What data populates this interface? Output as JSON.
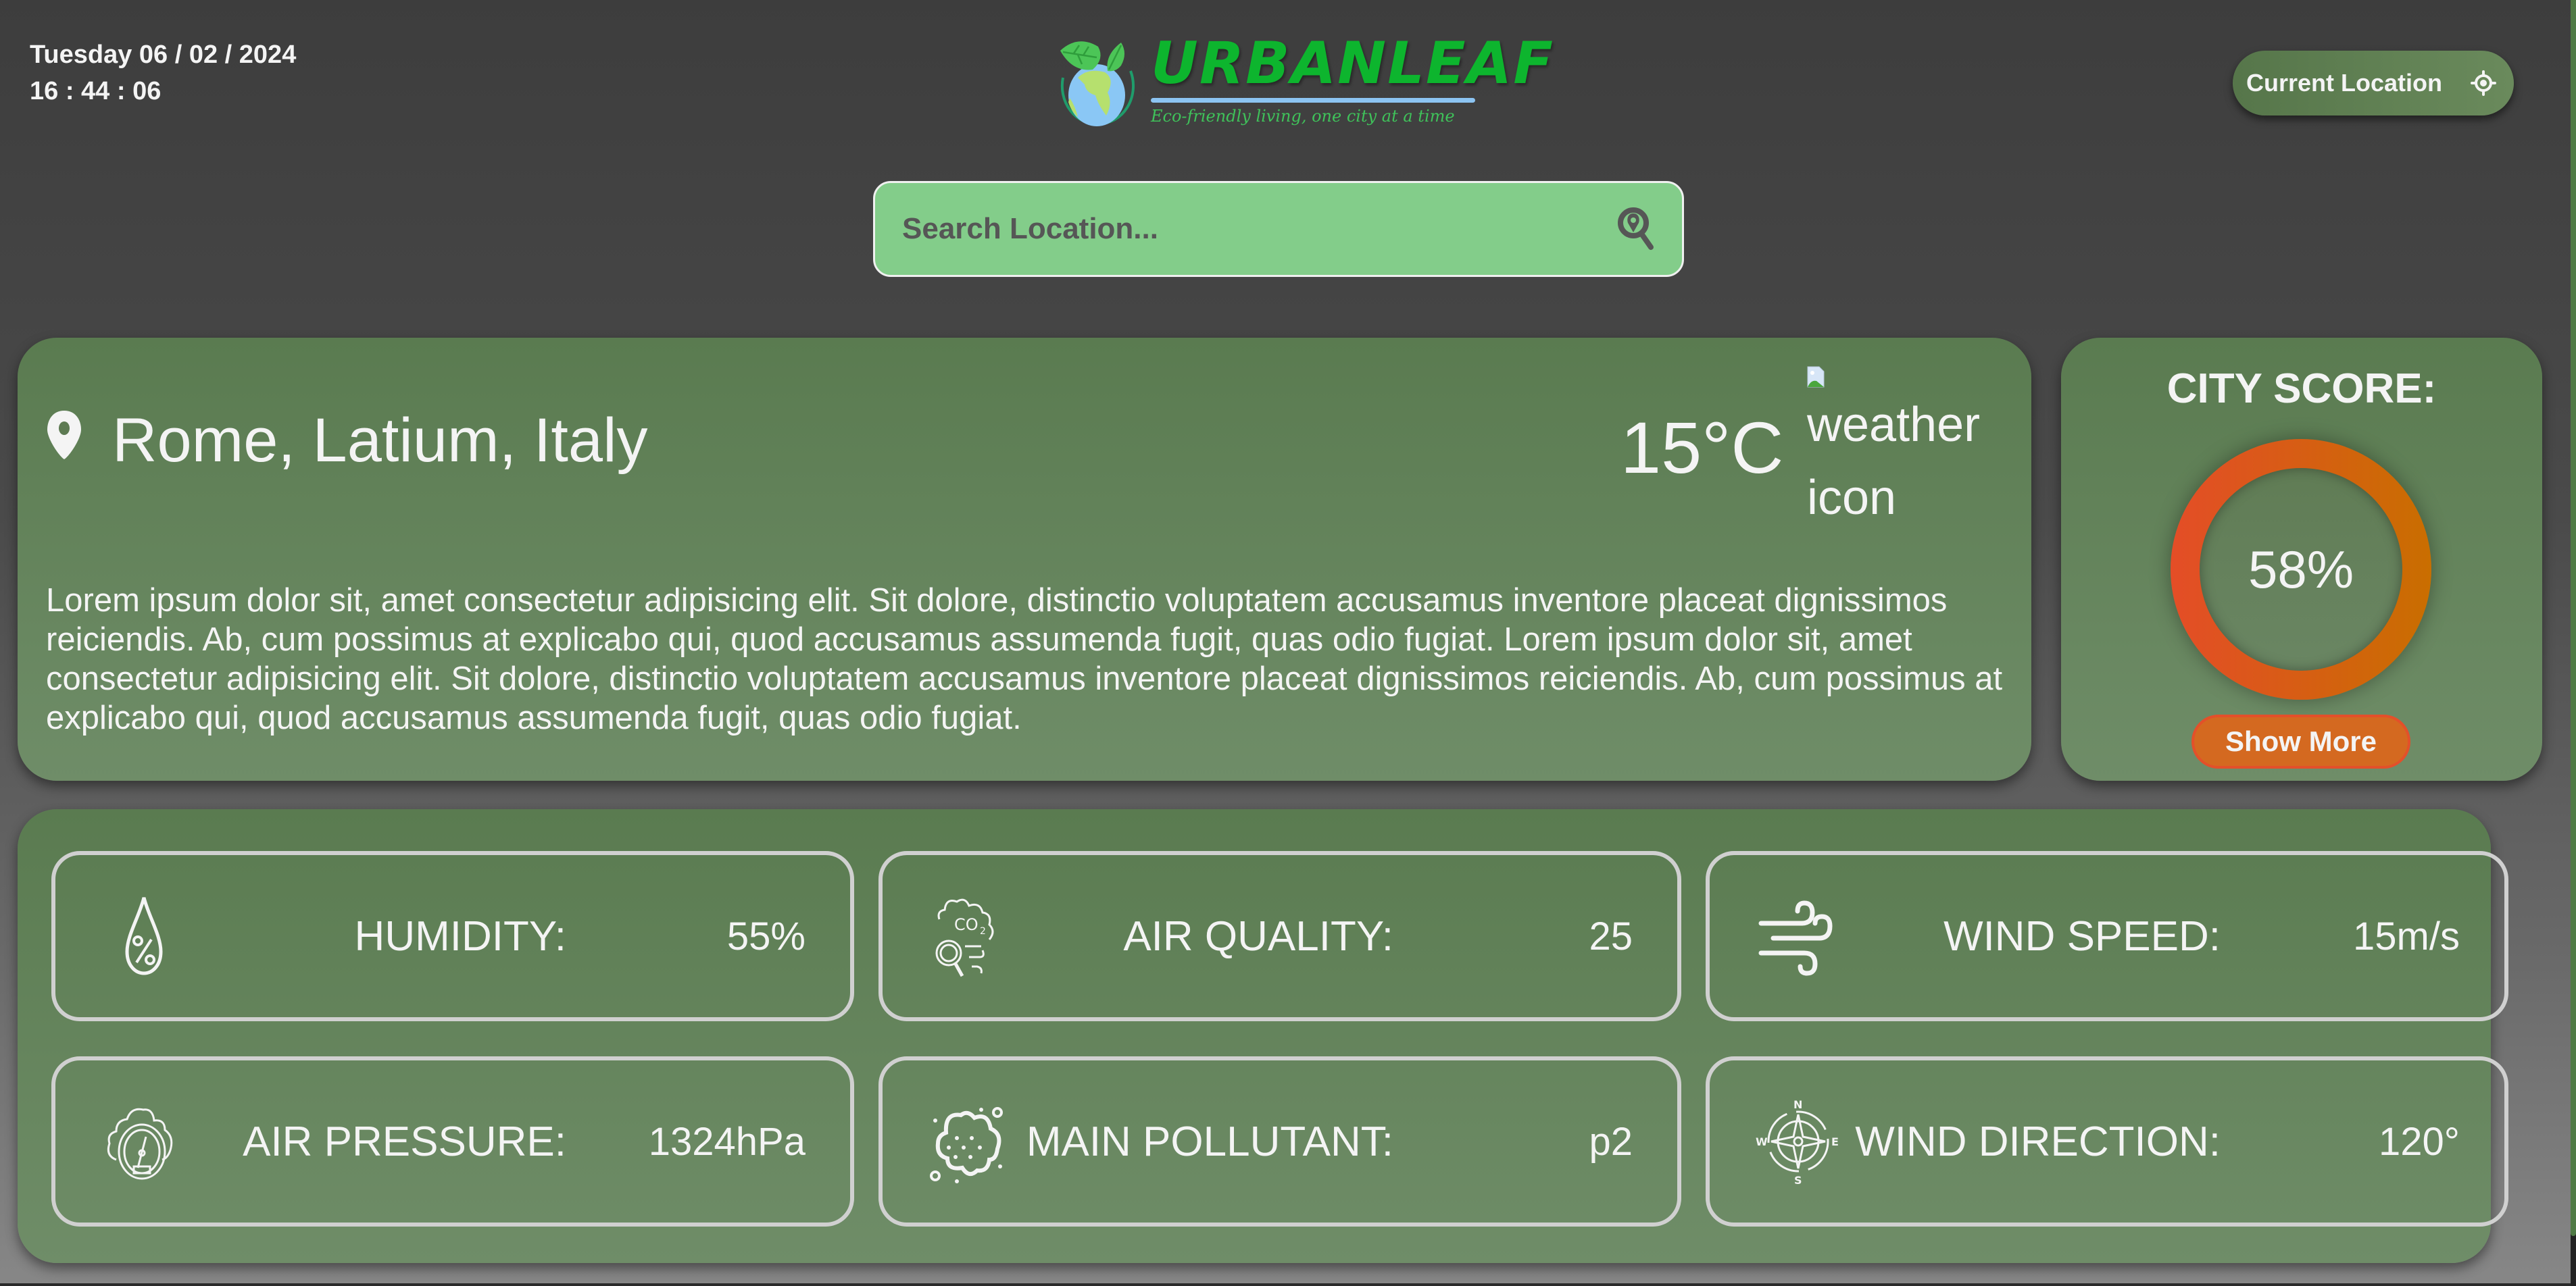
{
  "header": {
    "date": "Tuesday 06 / 02 / 2024",
    "time": "16 : 44 : 06",
    "logo_title": "URBANLEAF",
    "logo_tagline": "Eco-friendly living, one city at a time",
    "current_location_label": "Current Location"
  },
  "search": {
    "placeholder": "Search Location...",
    "value": ""
  },
  "location": {
    "name": "Rome, Latium, Italy",
    "temperature": "15°C",
    "weather_icon_alt": "weather icon",
    "description": "Lorem ipsum dolor sit, amet consectetur adipisicing elit. Sit dolore, distinctio voluptatem accusamus inventore placeat dignissimos reiciendis. Ab, cum possimus at explicabo qui, quod accusamus assumenda fugit, quas odio fugiat. Lorem ipsum dolor sit, amet consectetur adipisicing elit. Sit dolore, distinctio voluptatem accusamus inventore placeat dignissimos reiciendis. Ab, cum possimus at explicabo qui, quod accusamus assumenda fugit, quas odio fugiat."
  },
  "city_score": {
    "title": "CITY SCORE:",
    "value": "58%",
    "percent": 58,
    "show_more_label": "Show More",
    "colors": {
      "ring_start": "#e44d27",
      "ring_end": "#c96e00",
      "button": "#d46920"
    }
  },
  "stats": [
    {
      "icon": "humidity-drop-percent-icon",
      "label": "HUMIDITY:",
      "value": "55%"
    },
    {
      "icon": "co2-cloud-magnifier-icon",
      "label": "AIR QUALITY:",
      "value": "25"
    },
    {
      "icon": "wind-icon",
      "label": "WIND SPEED:",
      "value": "15m/s"
    },
    {
      "icon": "pressure-gauge-cloud-icon",
      "label": "AIR PRESSURE:",
      "value": "1324hPa"
    },
    {
      "icon": "pollutant-cloud-icon",
      "label": "MAIN POLLUTANT:",
      "value": "p2"
    },
    {
      "icon": "compass-icon",
      "label": "WIND DIRECTION:",
      "value": "120°"
    }
  ],
  "theme": {
    "card_green": "#5f7f55",
    "search_green": "#83cd8a",
    "logo_green": "#0db52e",
    "logo_line_blue": "#8cc4f2"
  }
}
